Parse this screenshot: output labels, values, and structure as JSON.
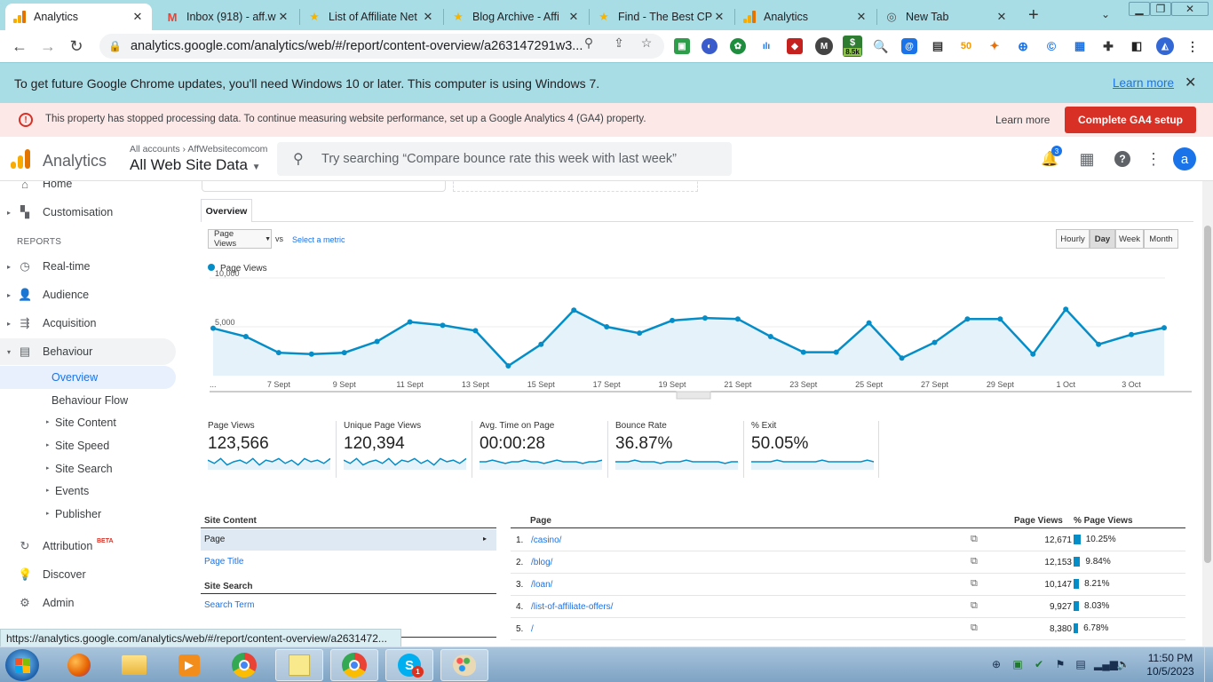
{
  "tabs": [
    {
      "title": "Analytics",
      "icon": "google-analytics-icon",
      "active": true
    },
    {
      "title": "Inbox (918) - aff.w",
      "icon": "gmail-icon"
    },
    {
      "title": "List of Affiliate Net",
      "icon": "star-icon"
    },
    {
      "title": "Blog Archive - Affi",
      "icon": "star-icon"
    },
    {
      "title": "Find - The Best CP",
      "icon": "star-icon"
    },
    {
      "title": "Analytics",
      "icon": "google-analytics-icon"
    },
    {
      "title": "New Tab",
      "icon": "chrome-icon"
    }
  ],
  "address_bar": {
    "url": "analytics.google.com/analytics/web/#/report/content-overview/a263147291w3..."
  },
  "extensions": {
    "badge_counter": "8.5k"
  },
  "info_bar": {
    "message": "To get future Google Chrome updates, you'll need Windows 10 or later. This computer is using Windows 7.",
    "link": "Learn more"
  },
  "ga4_banner": {
    "message": "This property has stopped processing data. To continue measuring website performance, set up a Google Analytics 4 (GA4) property.",
    "learn_more": "Learn more",
    "cta": "Complete GA4 setup"
  },
  "header": {
    "brand": "Analytics",
    "breadcrumb": "All accounts › AffWebsitecomcom",
    "property": "All Web Site Data",
    "search_placeholder": "Try searching “Compare bounce rate this week with last week”",
    "notification_count": "3",
    "avatar_letter": "a"
  },
  "sidebar": {
    "home": "Home",
    "customisation": "Customisation",
    "reports_heading": "REPORTS",
    "realtime": "Real-time",
    "audience": "Audience",
    "acquisition": "Acquisition",
    "behaviour": "Behaviour",
    "overview": "Overview",
    "behaviour_flow": "Behaviour Flow",
    "site_content": "Site Content",
    "site_speed": "Site Speed",
    "site_search": "Site Search",
    "events": "Events",
    "publisher": "Publisher",
    "attribution": "Attribution",
    "attribution_badge": "BETA",
    "discover": "Discover",
    "admin": "Admin"
  },
  "report": {
    "tab": "Overview",
    "metric_select": "Page Views",
    "vs": "vs",
    "select_metric": "Select a metric",
    "granularity": [
      "Hourly",
      "Day",
      "Week",
      "Month"
    ],
    "granularity_selected": "Day",
    "legend": "Page Views",
    "ellipsis": "..."
  },
  "chart_data": {
    "type": "area",
    "series": [
      {
        "name": "Page Views",
        "values": [
          4850,
          4000,
          2350,
          2200,
          2350,
          3500,
          5500,
          5150,
          4600,
          1000,
          3200,
          6700,
          5000,
          4350,
          5650,
          5900,
          5800,
          4000,
          2400,
          2400,
          5400,
          1800,
          3400,
          5800,
          5800,
          2200,
          6800,
          3200,
          4200,
          4900
        ]
      }
    ],
    "x_tick_labels": [
      "7 Sept",
      "9 Sept",
      "11 Sept",
      "13 Sept",
      "15 Sept",
      "17 Sept",
      "19 Sept",
      "21 Sept",
      "23 Sept",
      "25 Sept",
      "27 Sept",
      "29 Sept",
      "1 Oct",
      "3 Oct"
    ],
    "y_tick_labels": [
      "10,000",
      "5,000"
    ],
    "ylim": [
      0,
      10000
    ],
    "color": "#058dc7",
    "fill": "#e6f2f9"
  },
  "scorecards": [
    {
      "label": "Page Views",
      "value": "123,566",
      "spark": [
        6,
        4,
        7,
        3,
        5,
        6,
        4,
        7,
        3,
        6,
        5,
        7,
        4,
        6,
        3,
        7,
        5,
        6,
        4,
        7
      ]
    },
    {
      "label": "Unique Page Views",
      "value": "120,394",
      "spark": [
        6,
        4,
        7,
        3,
        5,
        6,
        4,
        7,
        3,
        6,
        5,
        7,
        4,
        6,
        3,
        7,
        5,
        6,
        4,
        7
      ]
    },
    {
      "label": "Avg. Time on Page",
      "value": "00:00:28",
      "spark": [
        5,
        5,
        6,
        5,
        4,
        5,
        5,
        6,
        5,
        5,
        4,
        5,
        6,
        5,
        5,
        5,
        4,
        5,
        5,
        6
      ]
    },
    {
      "label": "Bounce Rate",
      "value": "36.87%",
      "spark": [
        5,
        5,
        5,
        6,
        5,
        5,
        5,
        4,
        5,
        5,
        5,
        6,
        5,
        5,
        5,
        5,
        5,
        4,
        5,
        5
      ]
    },
    {
      "label": "% Exit",
      "value": "50.05%",
      "spark": [
        5,
        5,
        5,
        5,
        6,
        5,
        5,
        5,
        5,
        5,
        5,
        6,
        5,
        5,
        5,
        5,
        5,
        5,
        6,
        5
      ]
    }
  ],
  "left_table": {
    "site_content_heading": "Site Content",
    "page": "Page",
    "page_title": "Page Title",
    "site_search_heading": "Site Search",
    "search_term": "Search Term"
  },
  "right_table": {
    "headers": [
      "Page",
      "Page Views",
      "% Page Views"
    ],
    "rows": [
      {
        "rank": "1.",
        "page": "/casino/",
        "views": "12,671",
        "pct": "10.25%",
        "pct_value": 10.25
      },
      {
        "rank": "2.",
        "page": "/blog/",
        "views": "12,153",
        "pct": "9.84%",
        "pct_value": 9.84
      },
      {
        "rank": "3.",
        "page": "/loan/",
        "views": "10,147",
        "pct": "8.21%",
        "pct_value": 8.21
      },
      {
        "rank": "4.",
        "page": "/list-of-affiliate-offers/",
        "views": "9,927",
        "pct": "8.03%",
        "pct_value": 8.03
      },
      {
        "rank": "5.",
        "page": "/",
        "views": "8,380",
        "pct": "6.78%",
        "pct_value": 6.78
      }
    ]
  },
  "status_url": "https://analytics.google.com/analytics/web/#/report/content-overview/a2631472...",
  "taskbar": {
    "notification_badge": "1",
    "time": "11:50 PM",
    "date": "10/5/2023"
  }
}
